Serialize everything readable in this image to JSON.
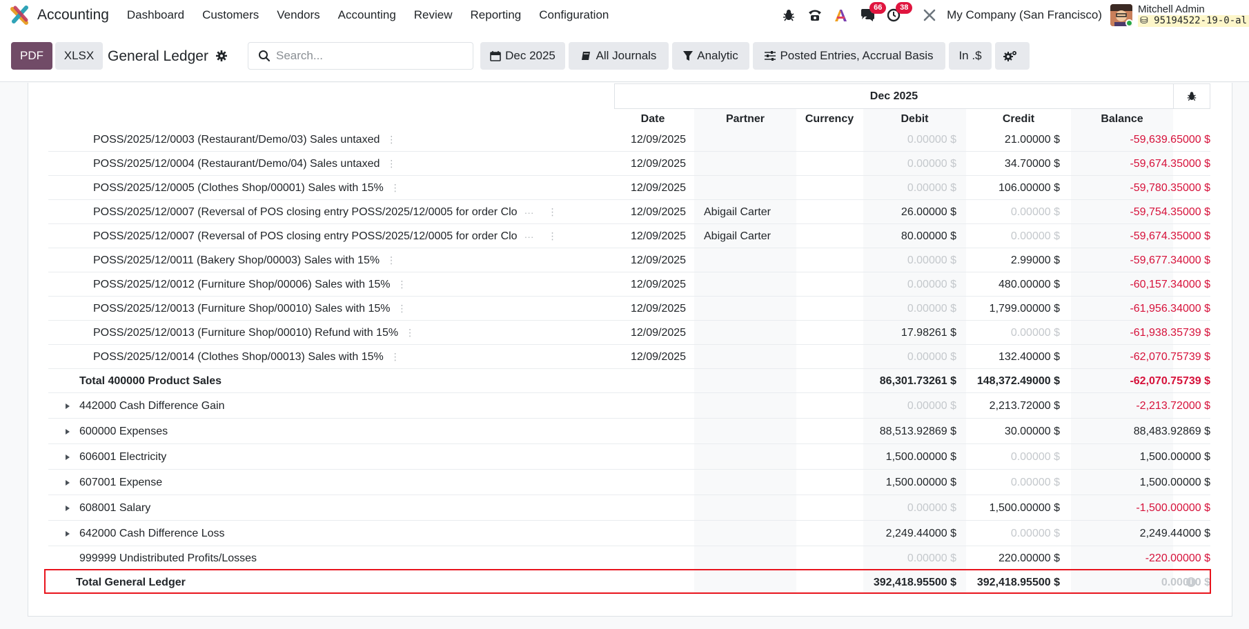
{
  "navbar": {
    "app_name": "Accounting",
    "menu": [
      "Dashboard",
      "Customers",
      "Vendors",
      "Accounting",
      "Review",
      "Reporting",
      "Configuration"
    ],
    "messages_count": "66",
    "activities_count": "38",
    "company": "My Company (San Francisco)",
    "user_name": "Mitchell Admin",
    "database": "95194522-19-0-al"
  },
  "controls": {
    "pdf_label": "PDF",
    "xlsx_label": "XLSX",
    "report_title": "General Ledger",
    "search_placeholder": "Search...",
    "date_filter": "Dec 2025",
    "journals_filter": "All Journals",
    "analytic_filter": "Analytic",
    "entries_filter": "Posted Entries, Accrual Basis",
    "currency_filter": "In .$"
  },
  "table": {
    "period": "Dec 2025",
    "columns": [
      "Date",
      "Partner",
      "Currency",
      "Debit",
      "Credit",
      "Balance"
    ],
    "lines": [
      {
        "name": "POSS/2025/12/0003 (Restaurant/Demo/03) Sales untaxed",
        "date": "12/09/2025",
        "partner": "",
        "debit": "0.00000 $",
        "credit": "21.00000 $",
        "balance": "-59,639.65000 $",
        "debit_zero": true,
        "credit_zero": false,
        "neg": true,
        "ellipsis": false
      },
      {
        "name": "POSS/2025/12/0004 (Restaurant/Demo/04) Sales untaxed",
        "date": "12/09/2025",
        "partner": "",
        "debit": "0.00000 $",
        "credit": "34.70000 $",
        "balance": "-59,674.35000 $",
        "debit_zero": true,
        "credit_zero": false,
        "neg": true,
        "ellipsis": false
      },
      {
        "name": "POSS/2025/12/0005 (Clothes Shop/00001) Sales with 15%",
        "date": "12/09/2025",
        "partner": "",
        "debit": "0.00000 $",
        "credit": "106.00000 $",
        "balance": "-59,780.35000 $",
        "debit_zero": true,
        "credit_zero": false,
        "neg": true,
        "ellipsis": false
      },
      {
        "name": "POSS/2025/12/0007 (Reversal of POS closing entry POSS/2025/12/0005 for order Clo",
        "date": "12/09/2025",
        "partner": "Abigail Carter",
        "debit": "26.00000 $",
        "credit": "0.00000 $",
        "balance": "-59,754.35000 $",
        "debit_zero": false,
        "credit_zero": true,
        "neg": true,
        "ellipsis": true
      },
      {
        "name": "POSS/2025/12/0007 (Reversal of POS closing entry POSS/2025/12/0005 for order Clo",
        "date": "12/09/2025",
        "partner": "Abigail Carter",
        "debit": "80.00000 $",
        "credit": "0.00000 $",
        "balance": "-59,674.35000 $",
        "debit_zero": false,
        "credit_zero": true,
        "neg": true,
        "ellipsis": true
      },
      {
        "name": "POSS/2025/12/0011 (Bakery Shop/00003) Sales with 15%",
        "date": "12/09/2025",
        "partner": "",
        "debit": "0.00000 $",
        "credit": "2.99000 $",
        "balance": "-59,677.34000 $",
        "debit_zero": true,
        "credit_zero": false,
        "neg": true,
        "ellipsis": false
      },
      {
        "name": "POSS/2025/12/0012 (Furniture Shop/00006) Sales with 15%",
        "date": "12/09/2025",
        "partner": "",
        "debit": "0.00000 $",
        "credit": "480.00000 $",
        "balance": "-60,157.34000 $",
        "debit_zero": true,
        "credit_zero": false,
        "neg": true,
        "ellipsis": false
      },
      {
        "name": "POSS/2025/12/0013 (Furniture Shop/00010) Sales with 15%",
        "date": "12/09/2025",
        "partner": "",
        "debit": "0.00000 $",
        "credit": "1,799.00000 $",
        "balance": "-61,956.34000 $",
        "debit_zero": true,
        "credit_zero": false,
        "neg": true,
        "ellipsis": false
      },
      {
        "name": "POSS/2025/12/0013 (Furniture Shop/00010) Refund with 15%",
        "date": "12/09/2025",
        "partner": "",
        "debit": "17.98261 $",
        "credit": "0.00000 $",
        "balance": "-61,938.35739 $",
        "debit_zero": false,
        "credit_zero": true,
        "neg": true,
        "ellipsis": false
      },
      {
        "name": "POSS/2025/12/0014 (Clothes Shop/00013) Sales with 15%",
        "date": "12/09/2025",
        "partner": "",
        "debit": "0.00000 $",
        "credit": "132.40000 $",
        "balance": "-62,070.75739 $",
        "debit_zero": true,
        "credit_zero": false,
        "neg": true,
        "ellipsis": false
      }
    ],
    "subtotal": {
      "name": "Total 400000 Product Sales",
      "debit": "86,301.73261 $",
      "credit": "148,372.49000 $",
      "balance": "-62,070.75739 $"
    },
    "accounts": [
      {
        "name": "442000 Cash Difference Gain",
        "debit": "0.00000 $",
        "credit": "2,213.72000 $",
        "balance": "-2,213.72000 $",
        "debit_zero": true,
        "credit_zero": false,
        "neg": true,
        "expandable": true
      },
      {
        "name": "600000 Expenses",
        "debit": "88,513.92869 $",
        "credit": "30.00000 $",
        "balance": "88,483.92869 $",
        "debit_zero": false,
        "credit_zero": false,
        "neg": false,
        "expandable": true
      },
      {
        "name": "606001 Electricity",
        "debit": "1,500.00000 $",
        "credit": "0.00000 $",
        "balance": "1,500.00000 $",
        "debit_zero": false,
        "credit_zero": true,
        "neg": false,
        "expandable": true
      },
      {
        "name": "607001 Expense",
        "debit": "1,500.00000 $",
        "credit": "0.00000 $",
        "balance": "1,500.00000 $",
        "debit_zero": false,
        "credit_zero": true,
        "neg": false,
        "expandable": true
      },
      {
        "name": "608001 Salary",
        "debit": "0.00000 $",
        "credit": "1,500.00000 $",
        "balance": "-1,500.00000 $",
        "debit_zero": true,
        "credit_zero": false,
        "neg": true,
        "expandable": true
      },
      {
        "name": "642000 Cash Difference Loss",
        "debit": "2,249.44000 $",
        "credit": "0.00000 $",
        "balance": "2,249.44000 $",
        "debit_zero": false,
        "credit_zero": true,
        "neg": false,
        "expandable": true
      },
      {
        "name": "999999 Undistributed Profits/Losses",
        "debit": "0.00000 $",
        "credit": "220.00000 $",
        "balance": "-220.00000 $",
        "debit_zero": true,
        "credit_zero": false,
        "neg": true,
        "expandable": false
      }
    ],
    "grand_total": {
      "name": "Total General Ledger",
      "debit": "392,418.95500 $",
      "credit": "392,418.95500 $",
      "balance": "0.00000 $"
    }
  },
  "colors": {
    "primary": "#714b67",
    "negative": "#d6113a",
    "highlight_box": "#e8131c"
  }
}
